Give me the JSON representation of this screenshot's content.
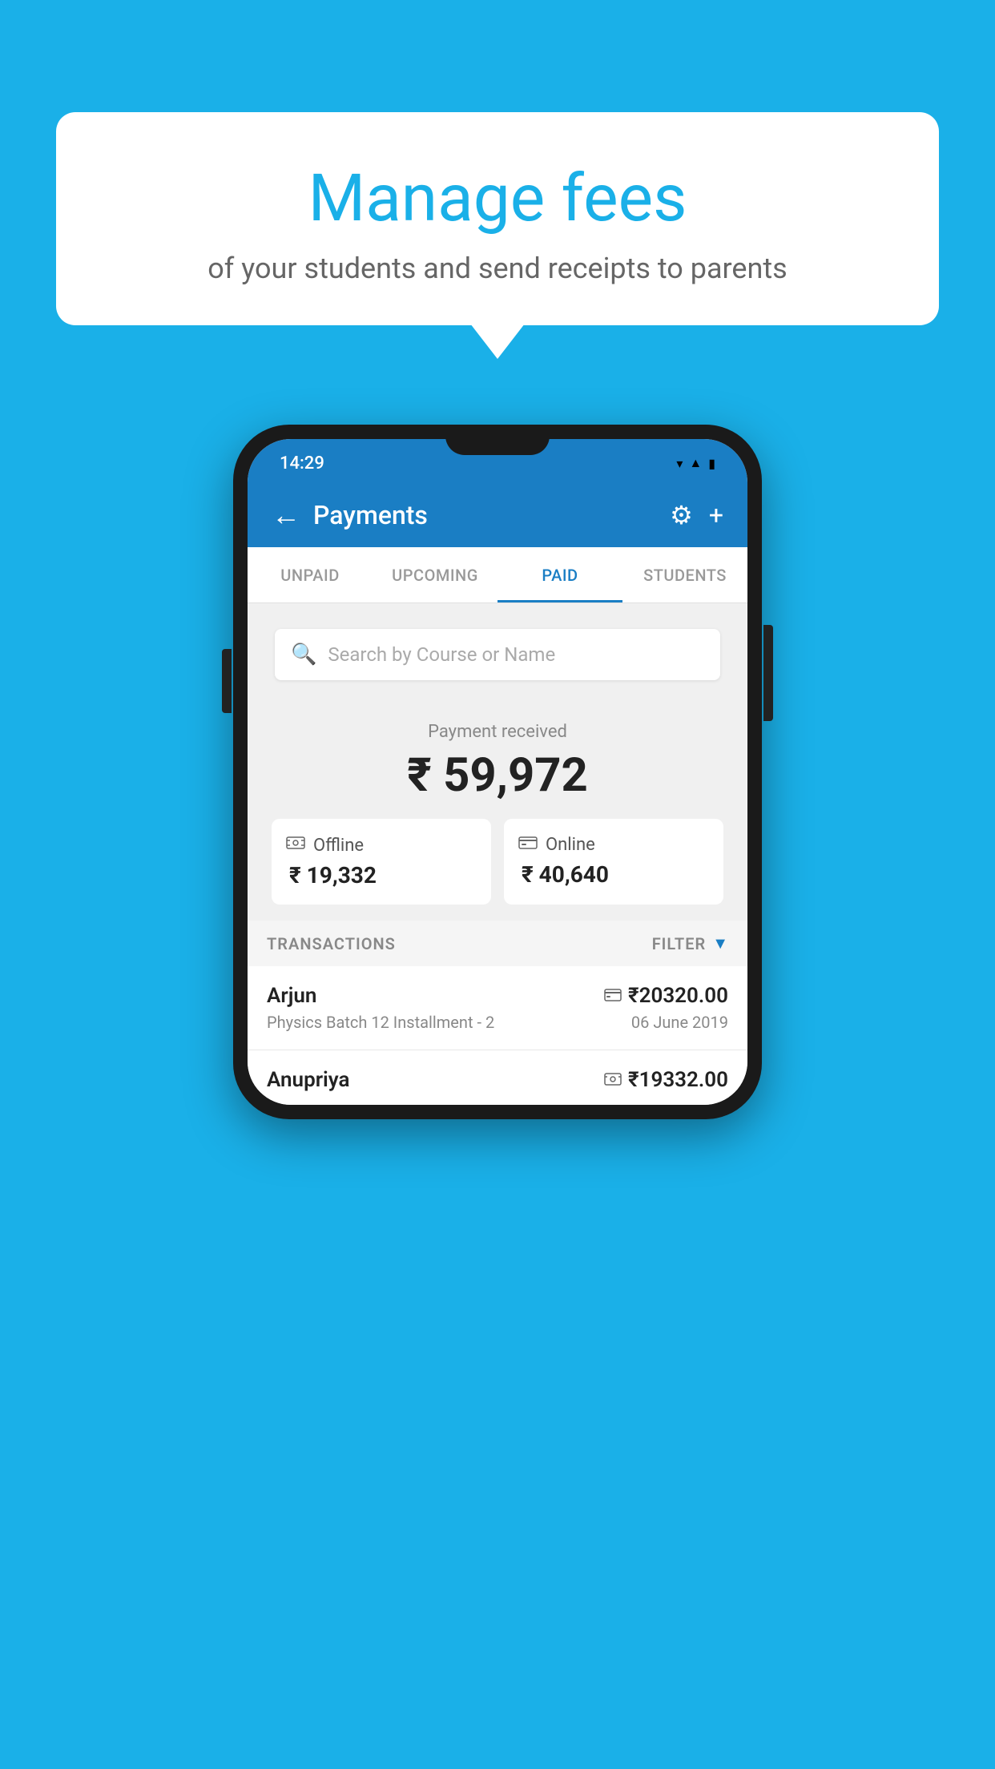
{
  "background_color": "#1ab0e8",
  "speech_bubble": {
    "title": "Manage fees",
    "subtitle": "of your students and send receipts to parents"
  },
  "status_bar": {
    "time": "14:29",
    "icons": [
      "wifi",
      "signal",
      "battery"
    ]
  },
  "header": {
    "title": "Payments",
    "back_label": "←",
    "gear_label": "⚙",
    "plus_label": "+"
  },
  "tabs": [
    {
      "label": "UNPAID",
      "active": false
    },
    {
      "label": "UPCOMING",
      "active": false
    },
    {
      "label": "PAID",
      "active": true
    },
    {
      "label": "STUDENTS",
      "active": false
    }
  ],
  "search": {
    "placeholder": "Search by Course or Name"
  },
  "payment_received": {
    "label": "Payment received",
    "amount": "₹ 59,972",
    "offline": {
      "label": "Offline",
      "amount": "₹ 19,332"
    },
    "online": {
      "label": "Online",
      "amount": "₹ 40,640"
    }
  },
  "transactions": {
    "header_label": "TRANSACTIONS",
    "filter_label": "FILTER",
    "rows": [
      {
        "name": "Arjun",
        "amount": "₹20320.00",
        "course": "Physics Batch 12 Installment - 2",
        "date": "06 June 2019",
        "icon_type": "card"
      },
      {
        "name": "Anupriya",
        "amount": "₹19332.00",
        "course": "",
        "date": "",
        "icon_type": "cash"
      }
    ]
  }
}
